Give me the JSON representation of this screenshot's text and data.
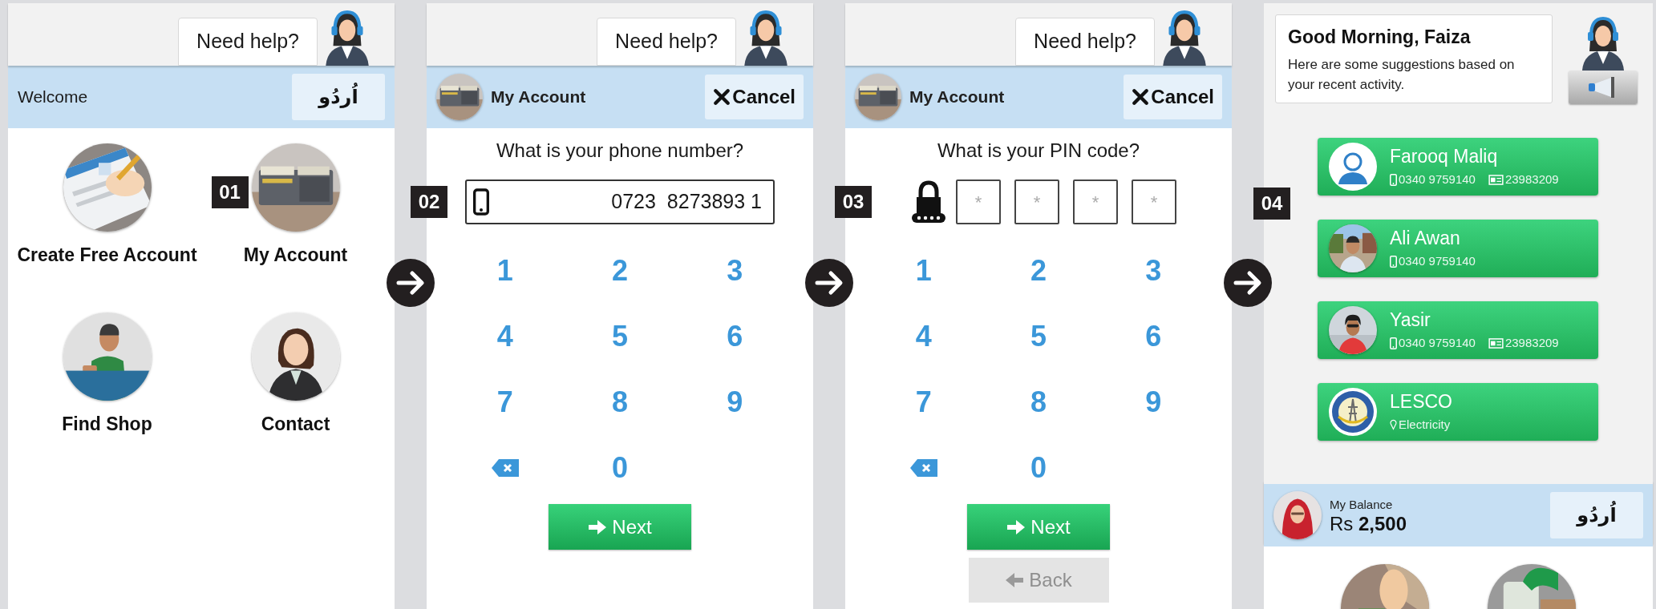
{
  "screens": [
    {
      "kind": "home",
      "help": "Need help?",
      "title": "Welcome",
      "language_button": "اُردُو",
      "tiles": [
        {
          "label": "Create Free Account"
        },
        {
          "label": "My Account",
          "badge": "01"
        },
        {
          "label": "Find Shop"
        },
        {
          "label": "Contact"
        }
      ]
    },
    {
      "kind": "phone",
      "help": "Need help?",
      "title": "My Account",
      "cancel": "Cancel",
      "badge": "02",
      "question": "What is your phone number?",
      "value": "0723  8273893 1",
      "keys": [
        {
          "kind": "digit",
          "label": "1"
        },
        {
          "kind": "digit",
          "label": "2"
        },
        {
          "kind": "digit",
          "label": "3"
        },
        {
          "kind": "digit",
          "label": "4"
        },
        {
          "kind": "digit",
          "label": "5"
        },
        {
          "kind": "digit",
          "label": "6"
        },
        {
          "kind": "digit",
          "label": "7"
        },
        {
          "kind": "digit",
          "label": "8"
        },
        {
          "kind": "digit",
          "label": "9"
        },
        {
          "kind": "delete"
        },
        {
          "kind": "digit",
          "label": "0"
        }
      ],
      "next": "Next"
    },
    {
      "kind": "pin",
      "help": "Need help?",
      "title": "My Account",
      "cancel": "Cancel",
      "badge": "03",
      "question": "What is your PIN code?",
      "pin_boxes": [
        "*",
        "*",
        "*",
        "*"
      ],
      "keys": [
        {
          "kind": "digit",
          "label": "1"
        },
        {
          "kind": "digit",
          "label": "2"
        },
        {
          "kind": "digit",
          "label": "3"
        },
        {
          "kind": "digit",
          "label": "4"
        },
        {
          "kind": "digit",
          "label": "5"
        },
        {
          "kind": "digit",
          "label": "6"
        },
        {
          "kind": "digit",
          "label": "7"
        },
        {
          "kind": "digit",
          "label": "8"
        },
        {
          "kind": "digit",
          "label": "9"
        },
        {
          "kind": "delete"
        },
        {
          "kind": "digit",
          "label": "0"
        }
      ],
      "next": "Next",
      "back": {
        "label": "Back",
        "disabled": true
      }
    },
    {
      "kind": "suggestions",
      "greeting": "Good Morning, Faiza",
      "subtitle": "Here are some suggestions based on your recent activity.",
      "badge": "04",
      "contacts": [
        {
          "name": "Farooq Maliq",
          "kind": "icon",
          "phone": "0340 9759140",
          "id_number": "23983209"
        },
        {
          "name": "Ali Awan",
          "kind": "picture",
          "phone": "0340 9759140"
        },
        {
          "name": "Yasir",
          "kind": "picture",
          "phone": "0340 9759140",
          "id_number": "23983209"
        },
        {
          "name": "LESCO",
          "kind": "logo",
          "category": "Electricity"
        }
      ],
      "balance_label": "My Balance",
      "balance": "Rs **2,500**",
      "language_button": "اُردُو"
    }
  ]
}
